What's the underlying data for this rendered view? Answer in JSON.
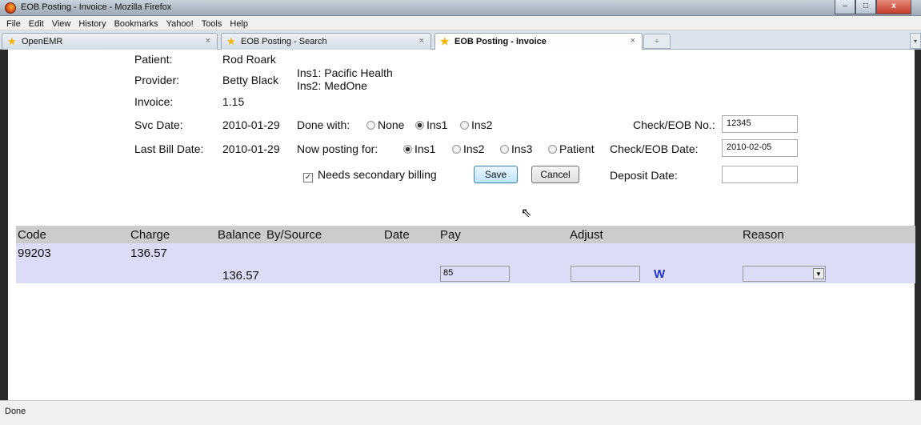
{
  "window": {
    "title": "EOB Posting - Invoice - Mozilla Firefox",
    "btn_min": "–",
    "btn_max": "□",
    "btn_close": "x"
  },
  "menu": [
    "File",
    "Edit",
    "View",
    "History",
    "Bookmarks",
    "Yahoo!",
    "Tools",
    "Help"
  ],
  "tabs": [
    {
      "label": "OpenEMR",
      "close": "×"
    },
    {
      "label": "EOB Posting - Search",
      "close": "×"
    },
    {
      "label": "EOB Posting - Invoice",
      "close": "×"
    }
  ],
  "new_tab": "+",
  "tab_list": "▾",
  "header": {
    "patient_label": "Patient:",
    "patient": "Rod Roark",
    "provider_label": "Provider:",
    "provider": "Betty Black",
    "ins1": "Ins1: Pacific Health",
    "ins2": "Ins2: MedOne",
    "invoice_label": "Invoice:",
    "invoice": "1.15",
    "svc_date_label": "Svc Date:",
    "svc_date": "2010-01-29",
    "last_bill_label": "Last Bill Date:",
    "last_bill": "2010-01-29",
    "done_with_label": "Done with:",
    "done_with_options": [
      "None",
      "Ins1",
      "Ins2"
    ],
    "done_with_selected": "Ins1",
    "posting_for_label": "Now posting for:",
    "posting_for_options": [
      "Ins1",
      "Ins2",
      "Ins3",
      "Patient"
    ],
    "posting_for_selected": "Ins1",
    "check_no_label": "Check/EOB No.:",
    "check_no": "12345",
    "check_date_label": "Check/EOB Date:",
    "check_date": "2010-02-05",
    "deposit_date_label": "Deposit Date:",
    "deposit_date": "",
    "secondary_billing_label": "Needs secondary billing",
    "secondary_billing_checked": true,
    "save_label": "Save",
    "cancel_label": "Cancel"
  },
  "table": {
    "columns": [
      "Code",
      "Charge",
      "Balance",
      "By/Source",
      "Date",
      "Pay",
      "Adjust",
      "Reason"
    ],
    "row": {
      "code": "99203",
      "charge": "136.57",
      "balance": "136.57",
      "pay": "85",
      "adjust": "",
      "w_link": "W",
      "reason": ""
    }
  },
  "status": "Done"
}
